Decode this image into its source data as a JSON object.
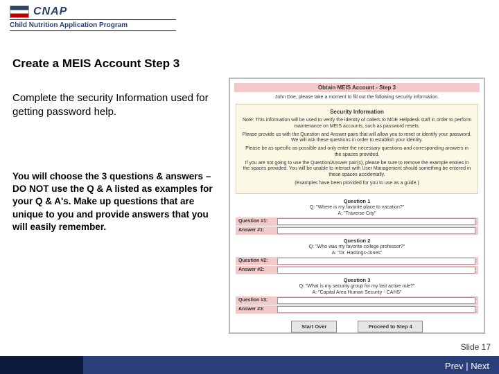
{
  "logo": {
    "acronym": "CNAP",
    "subtitle": "Child Nutrition Application Program"
  },
  "title": "Create a MEIS Account Step 3",
  "para1": "Complete the security Information used for getting password help.",
  "para2": "You will choose the 3 questions & answers – DO NOT use the Q & A listed as examples for your Q & A's. Make up questions that are unique to you and provide answers that you will easily remember.",
  "shot": {
    "title": "Obtain MEIS Account - Step 3",
    "intro": "John Doe, please take a moment to fill out the following security information.",
    "panel_header": "Security Information",
    "note": "Note: This information will be used to verify the identity of callers to MDE Helpdesk staff in order to perform maintenance on MEIS accounts, such as password resets.",
    "b1": "Please provide us with the Question and Answer pairs that will allow you to reset or identify your password. We will ask these questions in order to establish your identity.",
    "b2": "Please be as specific as possible and only enter the necessary questions and corresponding answers in the spaces provided.",
    "b3": "If you are not going to use the Question/Answer pair(s), please be sure to remove the example entries in the spaces provided. You will be unable to interact with User Management should something be entered in these spaces accidentally.",
    "b4": "(Examples have been provided for you to use as a guide.)",
    "q1_h": "Question 1",
    "q1_eq": "Q: \"Where is my favorite place to vacation?\"",
    "q1_ea": "A: \"Traverse City\"",
    "q1_lbl": "Question #1:",
    "a1_lbl": "Answer #1:",
    "q2_h": "Question 2",
    "q2_eq": "Q: \"Who was my favorite college professor?\"",
    "q2_ea": "A: \"Dr. Hastings-Jones\"",
    "q2_lbl": "Question #2:",
    "a2_lbl": "Answer #2:",
    "q3_h": "Question 3",
    "q3_eq": "Q: \"What is my security group for my last active role?\"",
    "q3_ea": "A: \"Capital Area Human Security - CAHS\"",
    "q3_lbl": "Question #3:",
    "a3_lbl": "Answer #3:",
    "btn_back": "Start Over",
    "btn_next": "Proceed to Step 4"
  },
  "slide_number": "Slide 17",
  "nav": {
    "prev": "Prev",
    "sep": " | ",
    "next": "Next"
  }
}
